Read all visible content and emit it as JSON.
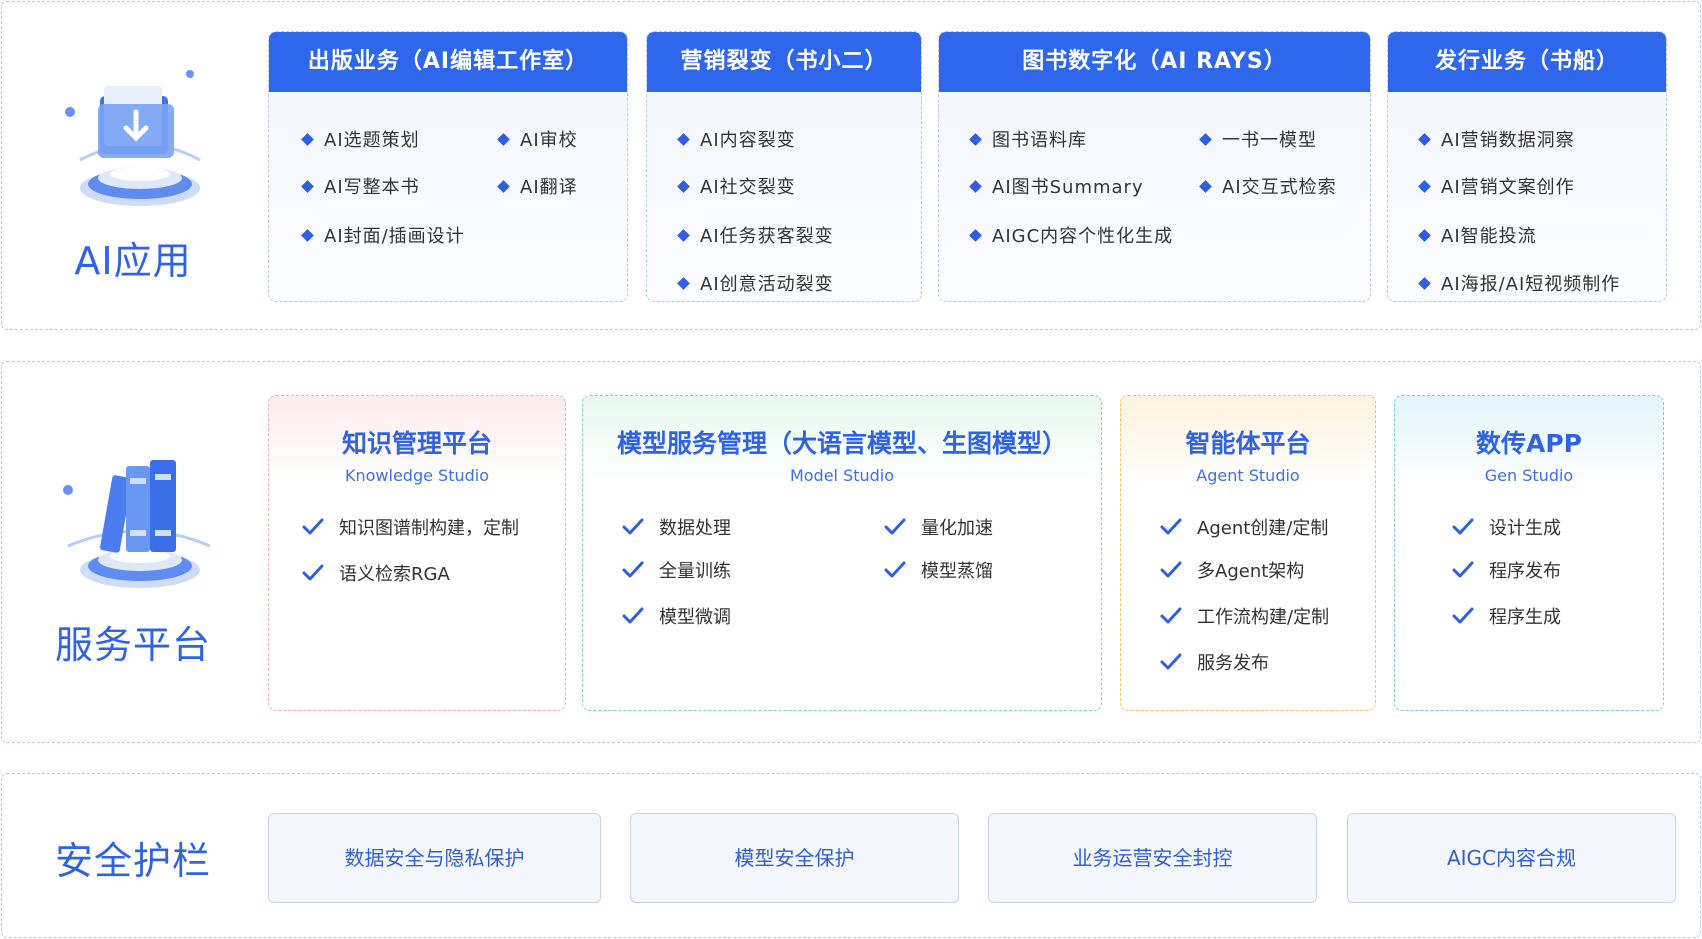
{
  "ai_app": {
    "title": "AI应用",
    "cards": [
      {
        "header": "出版业务（AI编辑工作室）",
        "items": [
          "AI选题策划",
          "AI审校",
          "AI写整本书",
          "AI翻译",
          "AI封面/插画设计"
        ]
      },
      {
        "header": "营销裂变（书小二）",
        "items": [
          "AI内容裂变",
          "AI社交裂变",
          "AI任务获客裂变",
          "AI创意活动裂变"
        ]
      },
      {
        "header": "图书数字化（AI RAYS）",
        "items": [
          "图书语料库",
          "一书一模型",
          "AI图书Summary",
          "AI交互式检索",
          "AIGC内容个性化生成"
        ]
      },
      {
        "header": "发行业务（书船）",
        "items": [
          "AI营销数据洞察",
          "AI营销文案创作",
          "AI智能投流",
          "AI海报/AI短视频制作"
        ]
      }
    ]
  },
  "platform": {
    "title": "服务平台",
    "cards": [
      {
        "title": "知识管理平台",
        "subtitle": "Knowledge Studio",
        "items": [
          "知识图谱制构建，定制",
          "语义检索RGA"
        ]
      },
      {
        "title": "模型服务管理（大语言模型、生图模型）",
        "subtitle": "Model Studio",
        "items": [
          "数据处理",
          "量化加速",
          "全量训练",
          "模型蒸馏",
          "模型微调"
        ]
      },
      {
        "title": "智能体平台",
        "subtitle": "Agent Studio",
        "items": [
          "Agent创建/定制",
          "多Agent架构",
          "工作流构建/定制",
          "服务发布"
        ]
      },
      {
        "title": "数传APP",
        "subtitle": "Gen Studio",
        "items": [
          "设计生成",
          "程序发布",
          "程序生成"
        ]
      }
    ]
  },
  "security": {
    "title": "安全护栏",
    "boxes": [
      "数据安全与隐私保护",
      "模型安全保护",
      "业务运营安全封控",
      "AIGC内容合规"
    ]
  },
  "colors": {
    "primary": "#2e66ec",
    "title_blue": "#2f63e4",
    "knowledge_accent": "#f5b5b5",
    "model_accent": "#8fdcb8",
    "agent_accent": "#f5c26b",
    "gen_accent": "#7fd3e0"
  },
  "icons": {
    "ai_app": "folder-download-icon",
    "platform": "books-icon",
    "bullet": "diamond-icon",
    "check": "check-icon"
  }
}
